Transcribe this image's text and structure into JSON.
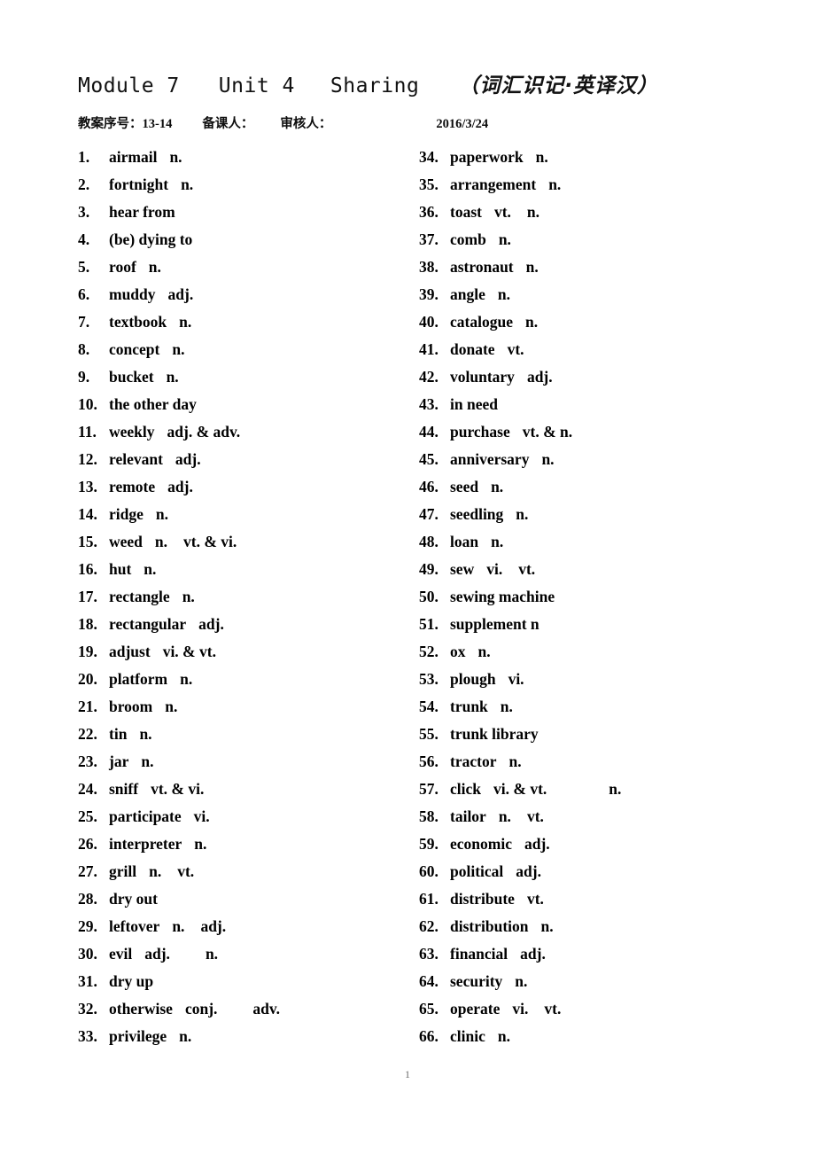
{
  "header": {
    "module": "Module 7",
    "unit": "Unit 4",
    "lesson": "Sharing",
    "cn_title": "（词汇识记·英译汉）"
  },
  "meta": {
    "plan_no_label": "教案序号：",
    "plan_no_value": "13-14",
    "preparer_label": "备课人：",
    "reviewer_label": "审核人：",
    "date": "2016/3/24"
  },
  "footer": {
    "page_number": "1"
  },
  "vocab": {
    "left_column": [
      {
        "num": "1.",
        "word": "airmail",
        "pos": "n.",
        "pos2": ""
      },
      {
        "num": "2.",
        "word": "fortnight",
        "pos": "n.",
        "pos2": ""
      },
      {
        "num": "3.",
        "word": "hear from",
        "pos": "",
        "pos2": ""
      },
      {
        "num": "4.",
        "word": "(be) dying to",
        "pos": "",
        "pos2": ""
      },
      {
        "num": "5.",
        "word": "roof",
        "pos": "n.",
        "pos2": ""
      },
      {
        "num": "6.",
        "word": "muddy",
        "pos": "adj.",
        "pos2": ""
      },
      {
        "num": "7.",
        "word": "textbook",
        "pos": "n.",
        "pos2": ""
      },
      {
        "num": "8.",
        "word": "concept",
        "pos": "n.",
        "pos2": ""
      },
      {
        "num": "9.",
        "word": "bucket",
        "pos": "n.",
        "pos2": ""
      },
      {
        "num": "10.",
        "word": "the other day",
        "pos": "",
        "pos2": ""
      },
      {
        "num": "11.",
        "word": "weekly",
        "pos": "adj. & adv.",
        "pos2": ""
      },
      {
        "num": "12.",
        "word": "relevant",
        "pos": "adj.",
        "pos2": ""
      },
      {
        "num": "13.",
        "word": "remote",
        "pos": "adj.",
        "pos2": ""
      },
      {
        "num": "14.",
        "word": "ridge",
        "pos": "n.",
        "pos2": ""
      },
      {
        "num": "15.",
        "word": "weed",
        "pos": "n.",
        "pos2": "vt. & vi."
      },
      {
        "num": "16.",
        "word": "hut",
        "pos": "n.",
        "pos2": ""
      },
      {
        "num": "17.",
        "word": "rectangle",
        "pos": "n.",
        "pos2": ""
      },
      {
        "num": "18.",
        "word": "rectangular",
        "pos": "adj.",
        "pos2": ""
      },
      {
        "num": "19.",
        "word": "adjust",
        "pos": "vi. & vt.",
        "pos2": ""
      },
      {
        "num": "20.",
        "word": "platform",
        "pos": "n.",
        "pos2": ""
      },
      {
        "num": "21.",
        "word": "broom",
        "pos": "n.",
        "pos2": ""
      },
      {
        "num": "22.",
        "word": "tin",
        "pos": "n.",
        "pos2": ""
      },
      {
        "num": "23.",
        "word": "jar",
        "pos": "n.",
        "pos2": ""
      },
      {
        "num": "24.",
        "word": "sniff",
        "pos": "vt. & vi.",
        "pos2": ""
      },
      {
        "num": "25.",
        "word": "participate",
        "pos": "vi.",
        "pos2": ""
      },
      {
        "num": "26.",
        "word": "interpreter",
        "pos": "n.",
        "pos2": ""
      },
      {
        "num": "27.",
        "word": "grill",
        "pos": "n.",
        "pos2": "vt."
      },
      {
        "num": "28.",
        "word": "dry out",
        "pos": "",
        "pos2": ""
      },
      {
        "num": "29.",
        "word": "leftover",
        "pos": "n.",
        "pos2": "adj."
      },
      {
        "num": "30.",
        "word": "evil",
        "pos": "adj.",
        "pos2": "n."
      },
      {
        "num": "31.",
        "word": "dry up",
        "pos": "",
        "pos2": ""
      },
      {
        "num": "32.",
        "word": "otherwise",
        "pos": "conj.",
        "pos2": "adv."
      },
      {
        "num": "33.",
        "word": "privilege",
        "pos": "n.",
        "pos2": ""
      }
    ],
    "right_column": [
      {
        "num": "34.",
        "word": "paperwork",
        "pos": "n.",
        "pos2": ""
      },
      {
        "num": "35.",
        "word": "arrangement",
        "pos": "n.",
        "pos2": ""
      },
      {
        "num": "36.",
        "word": "toast",
        "pos": "vt.",
        "pos2": "n."
      },
      {
        "num": "37.",
        "word": "comb",
        "pos": "n.",
        "pos2": ""
      },
      {
        "num": "38.",
        "word": "astronaut",
        "pos": "n.",
        "pos2": ""
      },
      {
        "num": "39.",
        "word": "angle",
        "pos": "n.",
        "pos2": ""
      },
      {
        "num": "40.",
        "word": "catalogue",
        "pos": "n.",
        "pos2": ""
      },
      {
        "num": "41.",
        "word": "donate",
        "pos": "vt.",
        "pos2": ""
      },
      {
        "num": "42.",
        "word": "voluntary",
        "pos": "adj.",
        "pos2": ""
      },
      {
        "num": "43.",
        "word": "in need",
        "pos": "",
        "pos2": ""
      },
      {
        "num": "44.",
        "word": "purchase",
        "pos": "vt. & n.",
        "pos2": ""
      },
      {
        "num": "45.",
        "word": "anniversary",
        "pos": "n.",
        "pos2": ""
      },
      {
        "num": "46.",
        "word": "seed",
        "pos": "n.",
        "pos2": ""
      },
      {
        "num": "47.",
        "word": "seedling",
        "pos": "n.",
        "pos2": ""
      },
      {
        "num": "48.",
        "word": "loan",
        "pos": "n.",
        "pos2": ""
      },
      {
        "num": "49.",
        "word": "sew",
        "pos": "vi.",
        "pos2": "vt."
      },
      {
        "num": "50.",
        "word": "sewing machine",
        "pos": "",
        "pos2": ""
      },
      {
        "num": "51.",
        "word": "supplement n",
        "pos": "",
        "pos2": ""
      },
      {
        "num": "52.",
        "word": "ox",
        "pos": "n.",
        "pos2": ""
      },
      {
        "num": "53.",
        "word": "plough",
        "pos": "vi.",
        "pos2": ""
      },
      {
        "num": "54.",
        "word": "trunk",
        "pos": "n.",
        "pos2": ""
      },
      {
        "num": "55.",
        "word": "trunk library",
        "pos": "",
        "pos2": ""
      },
      {
        "num": "56.",
        "word": "tractor",
        "pos": "n.",
        "pos2": ""
      },
      {
        "num": "57.",
        "word": "click",
        "pos": "vi. & vt.",
        "pos2": "n."
      },
      {
        "num": "58.",
        "word": "tailor",
        "pos": "n.",
        "pos2": "vt."
      },
      {
        "num": "59.",
        "word": "economic",
        "pos": "adj.",
        "pos2": ""
      },
      {
        "num": "60.",
        "word": "political",
        "pos": "adj.",
        "pos2": ""
      },
      {
        "num": "61.",
        "word": "distribute",
        "pos": "vt.",
        "pos2": ""
      },
      {
        "num": "62.",
        "word": "distribution",
        "pos": "n.",
        "pos2": ""
      },
      {
        "num": "63.",
        "word": "financial",
        "pos": "adj.",
        "pos2": ""
      },
      {
        "num": "64.",
        "word": "security",
        "pos": "n.",
        "pos2": ""
      },
      {
        "num": "65.",
        "word": "operate",
        "pos": "vi.",
        "pos2": "vt."
      },
      {
        "num": "66.",
        "word": "clinic",
        "pos": "n.",
        "pos2": ""
      }
    ]
  }
}
